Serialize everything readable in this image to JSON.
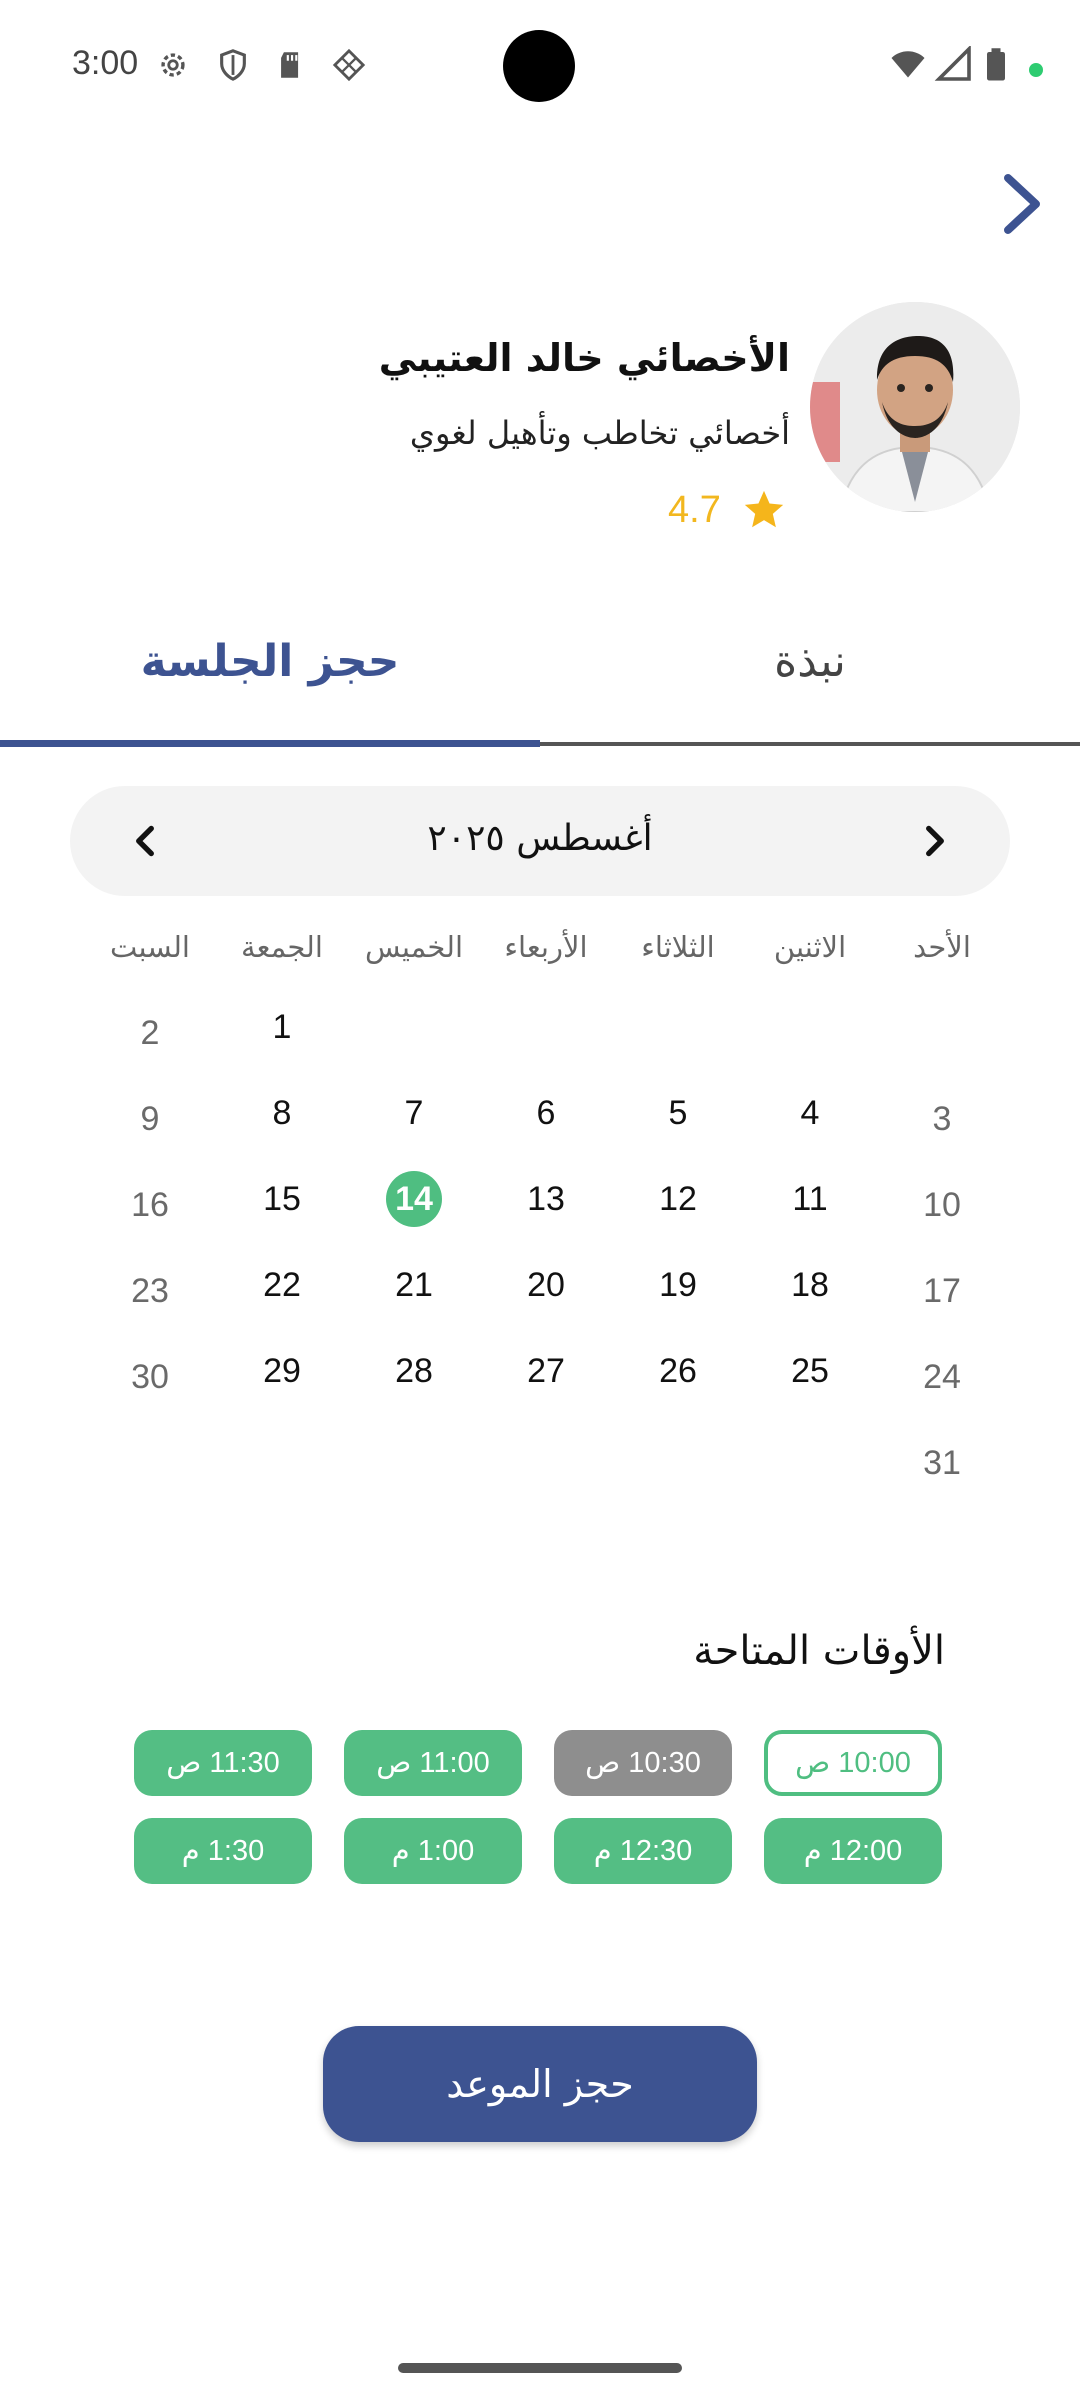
{
  "status_bar": {
    "time": "3:00",
    "icons": [
      "gear-icon",
      "shield-icon",
      "sd-card-icon",
      "grid-diamond-icon"
    ],
    "right_icons": [
      "wifi-icon",
      "cellular-icon",
      "battery-icon"
    ],
    "notification_dot_color": "#2ecc71"
  },
  "profile": {
    "name": "الأخصائي خالد العتيبي",
    "specialty": "أخصائي تخاطب وتأهيل لغوي",
    "rating": "4.7",
    "rating_color": "#f2b71f"
  },
  "tabs": {
    "booking": "حجز الجلسة",
    "about": "نبذة",
    "active": "booking"
  },
  "calendar": {
    "month_label": "أغسطس ٢٠٢٥",
    "weekdays": [
      "الأحد",
      "الاثنين",
      "الثلاثاء",
      "الأربعاء",
      "الخميس",
      "الجمعة",
      "السبت"
    ],
    "weeks": [
      [
        "",
        "",
        "",
        "",
        "",
        "1",
        "2"
      ],
      [
        "3",
        "4",
        "5",
        "6",
        "7",
        "8",
        "9"
      ],
      [
        "10",
        "11",
        "12",
        "13",
        "14",
        "15",
        "16"
      ],
      [
        "17",
        "18",
        "19",
        "20",
        "21",
        "22",
        "23"
      ],
      [
        "24",
        "25",
        "26",
        "27",
        "28",
        "29",
        "30"
      ],
      [
        "31",
        "",
        "",
        "",
        "",
        "",
        ""
      ]
    ],
    "selected_day": "14",
    "selected_color": "#4fbe81"
  },
  "slots": {
    "title": "الأوقات المتاحة",
    "items": [
      {
        "label": "10:00 ص",
        "state": "selected"
      },
      {
        "label": "10:30 ص",
        "state": "unavailable"
      },
      {
        "label": "11:00 ص",
        "state": "available"
      },
      {
        "label": "11:30 ص",
        "state": "available"
      },
      {
        "label": "12:00 م",
        "state": "available"
      },
      {
        "label": "12:30 م",
        "state": "available"
      },
      {
        "label": "1:00 م",
        "state": "available"
      },
      {
        "label": "1:30 م",
        "state": "available"
      }
    ]
  },
  "book_button": {
    "label": "حجز الموعد",
    "color": "#3d5391"
  }
}
